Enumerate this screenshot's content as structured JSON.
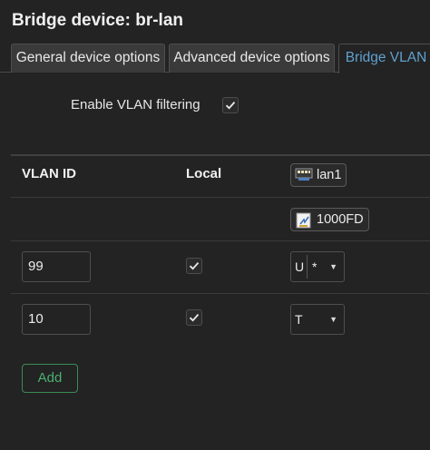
{
  "title": "Bridge device: br-lan",
  "tabs": [
    {
      "label": "General device options",
      "active": false
    },
    {
      "label": "Advanced device options",
      "active": false
    },
    {
      "label": "Bridge VLAN",
      "active": true
    }
  ],
  "vlan_filtering": {
    "label": "Enable VLAN filtering",
    "checked": true
  },
  "table": {
    "headers": {
      "vlan_id": "VLAN ID",
      "local": "Local"
    },
    "port": {
      "name": "lan1",
      "speed": "1000FD"
    },
    "rows": [
      {
        "vlan_id": "99",
        "local": true,
        "mode": "U",
        "extra": "*"
      },
      {
        "vlan_id": "10",
        "local": true,
        "mode": "T",
        "extra": ""
      }
    ]
  },
  "add_label": "Add",
  "colors": {
    "background": "#232323",
    "accent": "#5fa0cf",
    "add": "#4caf72"
  }
}
